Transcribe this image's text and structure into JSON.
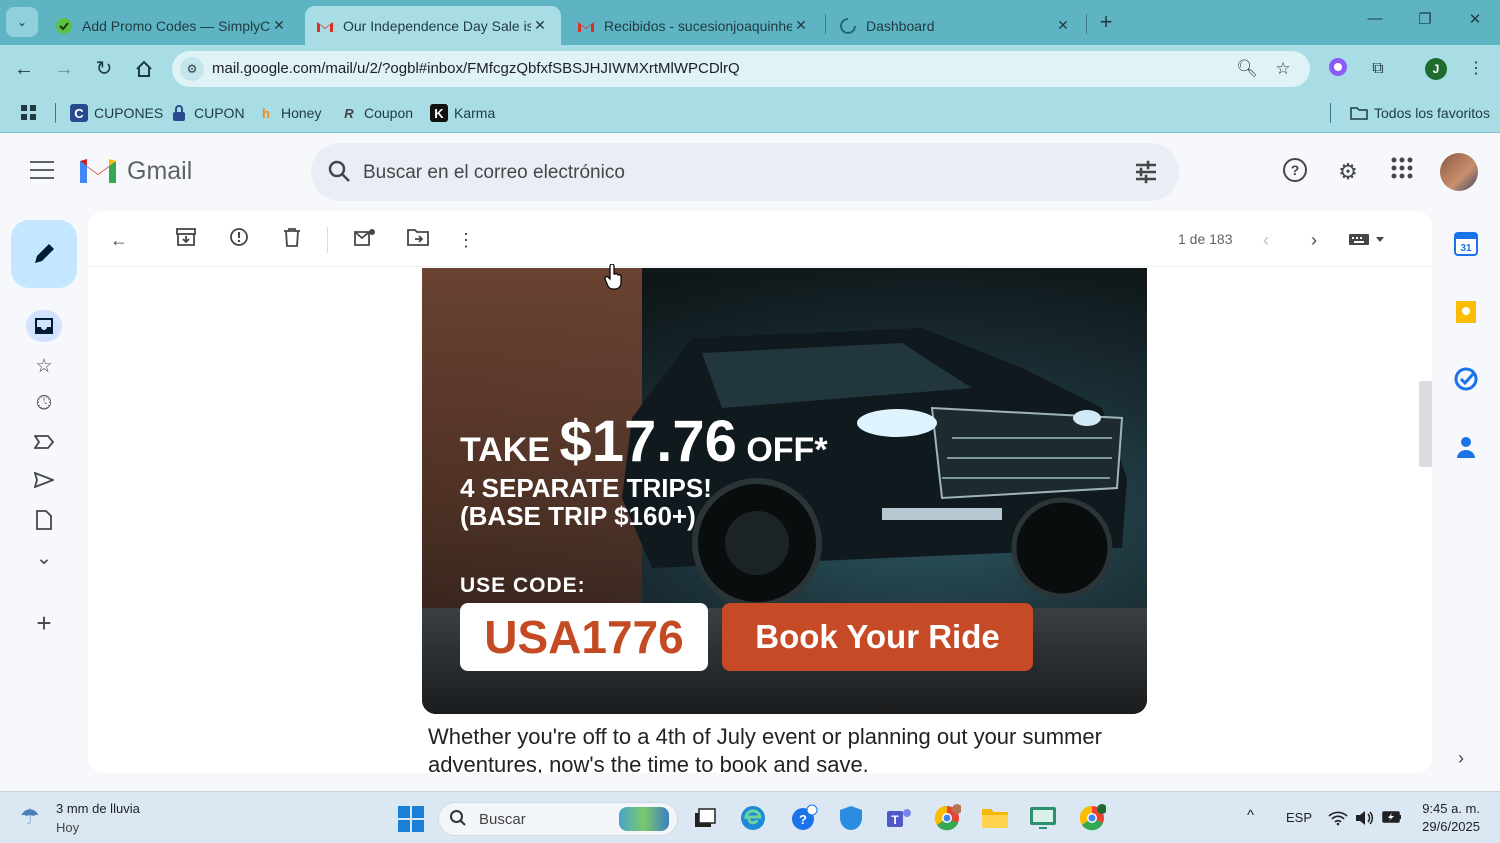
{
  "browser": {
    "tabs": [
      {
        "title": "Add Promo Codes — SimplyCo",
        "favicon": "simplycodes-icon",
        "active": false
      },
      {
        "title": "Our Independence Day Sale is F",
        "favicon": "gmail-icon",
        "active": true
      },
      {
        "title": "Recibidos - sucesionjoaquinher",
        "favicon": "gmail-icon",
        "active": false
      },
      {
        "title": "Dashboard",
        "favicon": "loading-spinner-icon",
        "active": false
      }
    ],
    "url": "mail.google.com/mail/u/2/?ogbl#inbox/FMfcgzQbfxfSBSJHJIWMXrtMlWPCDlrQ",
    "bookmarks": [
      {
        "label": "CUPONES",
        "icon": "bookmark-cupones-icon"
      },
      {
        "label": "CUPON",
        "icon": "lock-icon"
      },
      {
        "label": "Honey",
        "icon": "honey-icon"
      },
      {
        "label": "Coupon",
        "icon": "coupon-icon"
      },
      {
        "label": "Karma",
        "icon": "karma-icon"
      }
    ],
    "all_bookmarks_label": "Todos los favoritos",
    "profile_initial": "J",
    "theme_color": "#a9dde6"
  },
  "gmail": {
    "logo_text": "Gmail",
    "search_placeholder": "Buscar en el correo electrónico",
    "pager": "1 de 183"
  },
  "email": {
    "promo": {
      "take": "TAKE",
      "amount": "$17.76",
      "off": "OFF*",
      "line2": "4 SEPARATE TRIPS!",
      "line3": "(BASE TRIP $160+)",
      "code_label": "USE CODE:",
      "code": "USA1776",
      "button": "Book Your Ride",
      "button_color": "#c74a26"
    },
    "body": "Whether you're off to a 4th of July event or planning out your summer adventures, now's the time to book and save."
  },
  "taskbar": {
    "weather_line1": "3 mm de lluvia",
    "weather_line2": "Hoy",
    "search_placeholder": "Buscar",
    "language": "ESP",
    "time": "9:45 a. m.",
    "date": "29/6/2025"
  }
}
